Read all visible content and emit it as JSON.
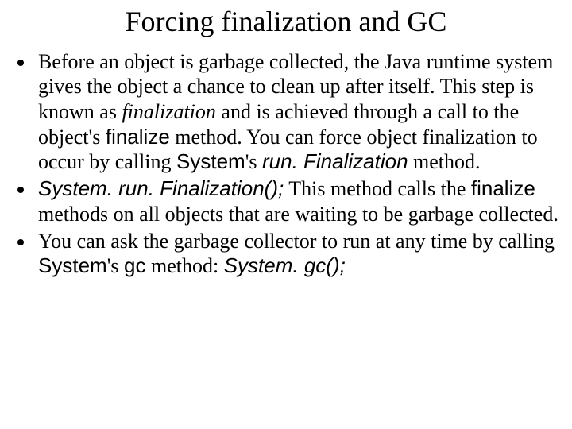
{
  "title": "Forcing finalization and GC",
  "b1": {
    "t1": "Before an object is garbage collected, the Java runtime system gives the object a chance to clean up after itself. This step is known as ",
    "t2": "finalization",
    "t3": " and is achieved through a call to the object's ",
    "t4": "finalize",
    "t5": " method. You can force object finalization to occur by calling ",
    "t6": "System",
    "t7": "'s ",
    "t8": "run. Finalization",
    "t9": " method."
  },
  "b2": {
    "t1": "System. run. Finalization();",
    "t2": " This method calls the ",
    "t3": "finalize",
    "t4": " methods on all objects that are waiting to be garbage collected."
  },
  "b3": {
    "t1": "You can ask the garbage collector to run at any time by calling ",
    "t2": "System",
    "t3": "'s ",
    "t4": "gc",
    "t5": " method: ",
    "t6": "System. gc();"
  }
}
